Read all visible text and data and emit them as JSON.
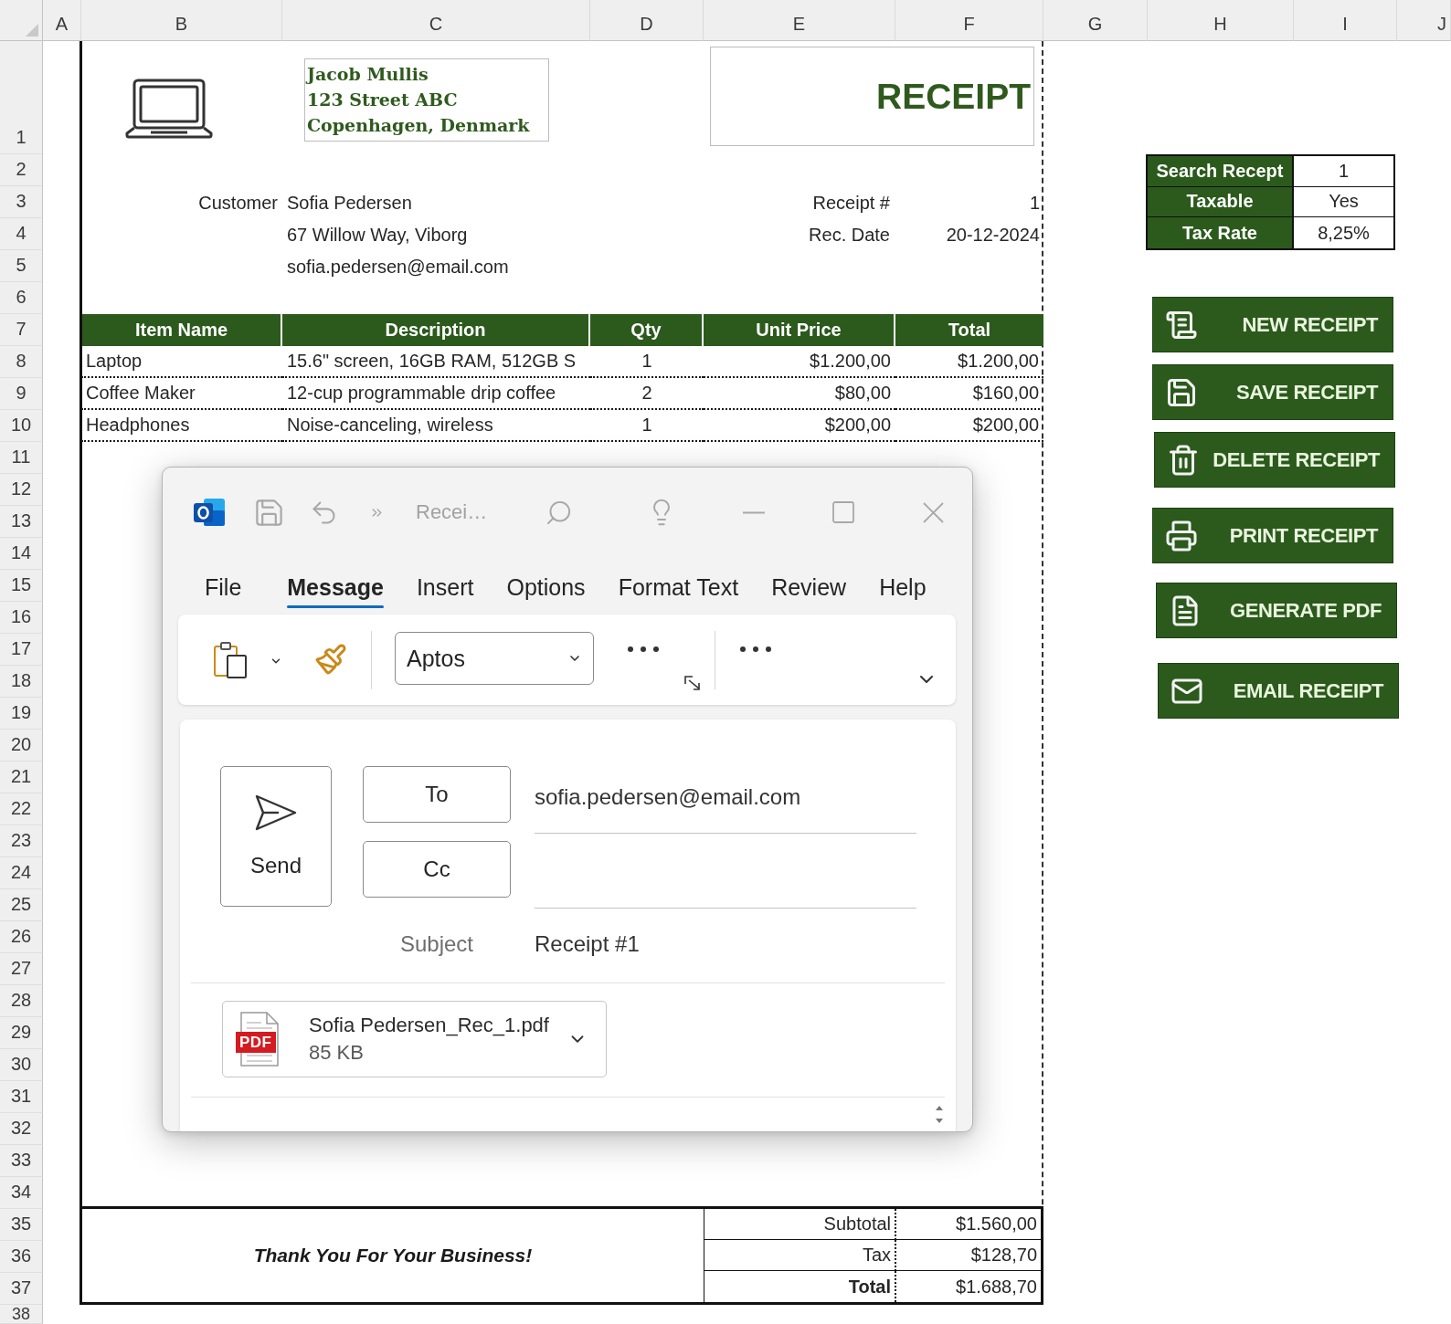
{
  "column_headers": [
    "A",
    "B",
    "C",
    "D",
    "E",
    "F",
    "G",
    "H",
    "I",
    "J"
  ],
  "row_headers": [
    "1",
    "2",
    "3",
    "4",
    "5",
    "6",
    "7",
    "8",
    "9",
    "10",
    "11",
    "12",
    "13",
    "14",
    "15",
    "16",
    "17",
    "18",
    "19",
    "20",
    "21",
    "22",
    "23",
    "24",
    "25",
    "26",
    "27",
    "28",
    "29",
    "30",
    "31",
    "32",
    "33",
    "34",
    "35",
    "36",
    "37",
    "38"
  ],
  "receipt": {
    "company_lines": [
      "Jacob Mullis",
      "123 Street ABC",
      "Copenhagen, Denmark"
    ],
    "title": "RECEIPT",
    "customer_label": "Customer",
    "customer_lines": [
      "Sofia Pedersen",
      "67 Willow Way, Viborg",
      "sofia.pedersen@email.com"
    ],
    "details": [
      {
        "label": "Receipt #",
        "value": "1"
      },
      {
        "label": "Rec. Date",
        "value": "20-12-2024"
      }
    ],
    "items": {
      "columns": [
        "Item Name",
        "Description",
        "Qty",
        "Unit Price",
        "Total"
      ],
      "rows": [
        [
          "Laptop",
          "15.6\" screen, 16GB RAM, 512GB S",
          "1",
          "$1.200,00",
          "$1.200,00"
        ],
        [
          "Coffee Maker",
          "12-cup programmable drip coffee",
          "2",
          "$80,00",
          "$160,00"
        ],
        [
          "Headphones",
          "Noise-canceling, wireless",
          "1",
          "$200,00",
          "$200,00"
        ]
      ]
    },
    "thank_you": "Thank You For Your Business!",
    "totals": [
      {
        "label": "Subtotal",
        "value": "$1.560,00",
        "emphasized": false
      },
      {
        "label": "Tax",
        "value": "$128,70",
        "emphasized": false
      },
      {
        "label": "Total",
        "value": "$1.688,70",
        "emphasized": true
      }
    ]
  },
  "settings": [
    {
      "label": "Search Recept",
      "value": "1"
    },
    {
      "label": "Taxable",
      "value": "Yes"
    },
    {
      "label": "Tax Rate",
      "value": "8,25%"
    }
  ],
  "action_buttons": [
    "NEW RECEIPT",
    "SAVE RECEIPT",
    "DELETE RECEIPT",
    "PRINT RECEIPT",
    "GENERATE PDF",
    "EMAIL RECEIPT"
  ],
  "email_window": {
    "title": "Recei…",
    "ribbon_tabs": [
      {
        "label": "File",
        "selected": false
      },
      {
        "label": "Message",
        "selected": true
      },
      {
        "label": "Insert",
        "selected": false
      },
      {
        "label": "Options",
        "selected": false
      },
      {
        "label": "Format Text",
        "selected": false
      },
      {
        "label": "Review",
        "selected": false
      },
      {
        "label": "Help",
        "selected": false
      }
    ],
    "font": "Aptos",
    "send": "Send",
    "recipients": [
      {
        "button": "To",
        "value": "sofia.pedersen@email.com"
      },
      {
        "button": "Cc"
      }
    ],
    "subject_label": "Subject",
    "subject": "Receipt #1",
    "attachment": {
      "type_badge": "PDF",
      "name": "Sofia Pedersen_Rec_1.pdf",
      "size": "85 KB"
    }
  }
}
